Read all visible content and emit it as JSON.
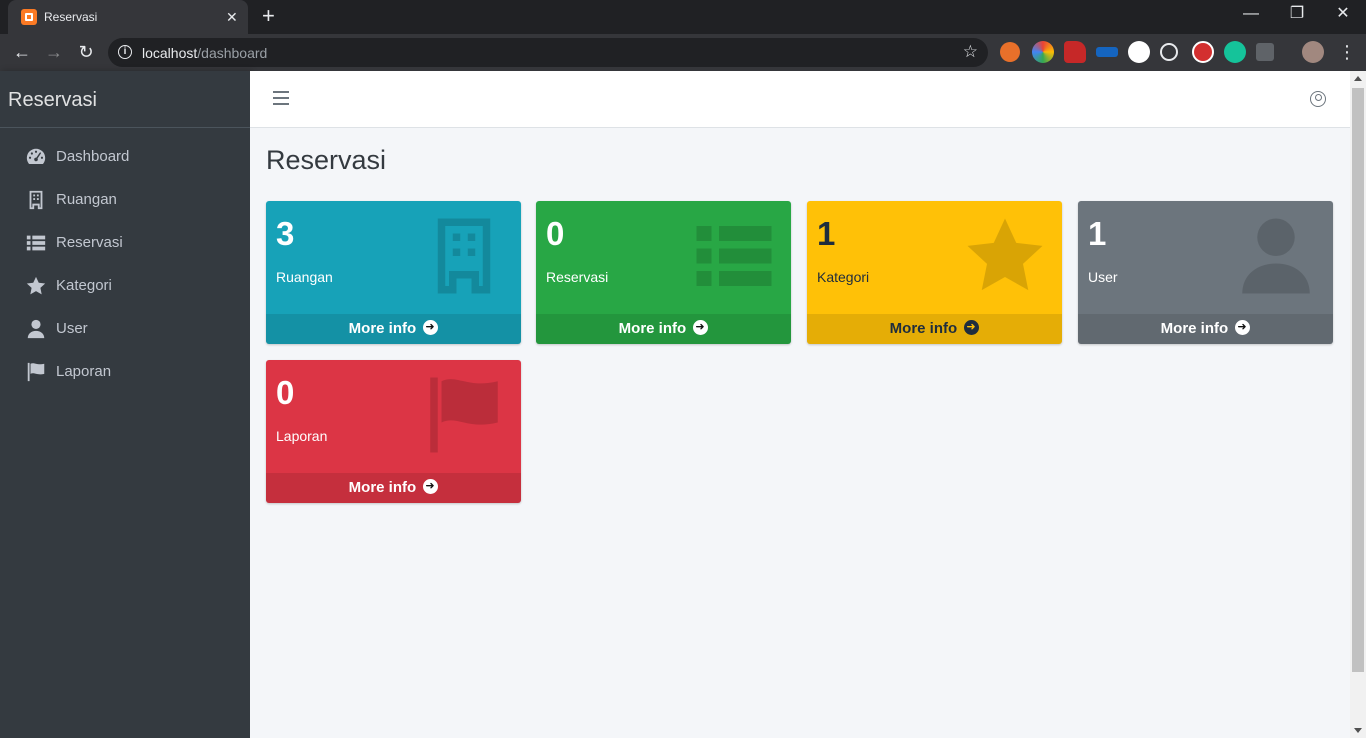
{
  "browser": {
    "tab_title": "Reservasi",
    "tab_close": "✕",
    "new_tab": "+",
    "url_host": "localhost",
    "url_path": "/dashboard",
    "window_controls": [
      "—",
      "❐",
      "✕"
    ],
    "extensions": [
      "ext-orange-icon",
      "ext-colorwheel-icon",
      "ext-santa-icon",
      "ext-plane-icon",
      "ext-json-icon",
      "ext-react-icon",
      "ext-abp-icon",
      "ext-grammarly-icon",
      "ext-facebook-icon",
      "profile-avatar"
    ]
  },
  "sidebar": {
    "brand": "Reservasi",
    "items": [
      {
        "label": "Dashboard",
        "icon": "tachometer-icon"
      },
      {
        "label": "Ruangan",
        "icon": "building-icon"
      },
      {
        "label": "Reservasi",
        "icon": "list-icon"
      },
      {
        "label": "Kategori",
        "icon": "star-icon"
      },
      {
        "label": "User",
        "icon": "user-icon"
      },
      {
        "label": "Laporan",
        "icon": "flag-icon"
      }
    ]
  },
  "page": {
    "title": "Reservasi"
  },
  "cards": [
    {
      "value": "3",
      "label": "Ruangan",
      "link": "More info",
      "color": "#17a2b8",
      "icon": "building-icon"
    },
    {
      "value": "0",
      "label": "Reservasi",
      "link": "More info",
      "color": "#28a745",
      "icon": "list-icon"
    },
    {
      "value": "1",
      "label": "Kategori",
      "link": "More info",
      "color": "#ffc107",
      "icon": "star-icon"
    },
    {
      "value": "1",
      "label": "User",
      "link": "More info",
      "color": "#6c757d",
      "icon": "user-icon"
    },
    {
      "value": "0",
      "label": "Laporan",
      "link": "More info",
      "color": "#dc3545",
      "icon": "flag-icon"
    }
  ]
}
